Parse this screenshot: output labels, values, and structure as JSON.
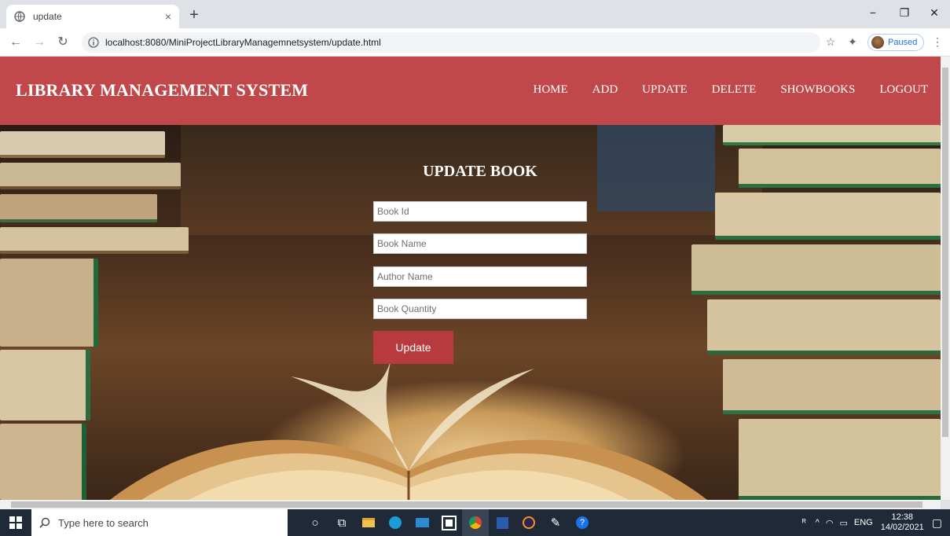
{
  "browser": {
    "tab_title": "update",
    "tab_close": "×",
    "new_tab": "+",
    "url": "localhost:8080/MiniProjectLibraryManagemnetsystem/update.html",
    "profile_status": "Paused",
    "minimize": "−",
    "restore": "❐",
    "close": "✕"
  },
  "nav": {
    "brand": "LIBRARY MANAGEMENT SYSTEM",
    "links": [
      "HOME",
      "ADD",
      "UPDATE",
      "DELETE",
      "SHOWBOOKS",
      "LOGOUT"
    ]
  },
  "form": {
    "title": "UPDATE BOOK",
    "fields": [
      {
        "placeholder": "Book Id",
        "value": ""
      },
      {
        "placeholder": "Book Name",
        "value": ""
      },
      {
        "placeholder": "Author Name",
        "value": ""
      },
      {
        "placeholder": "Book Quantity",
        "value": ""
      }
    ],
    "submit_label": "Update"
  },
  "taskbar": {
    "search_placeholder": "Type here to search",
    "language": "ENG",
    "time": "12:38",
    "date": "14/02/2021"
  },
  "colors": {
    "navbar": "#c0484a",
    "button": "#b73a3e"
  }
}
